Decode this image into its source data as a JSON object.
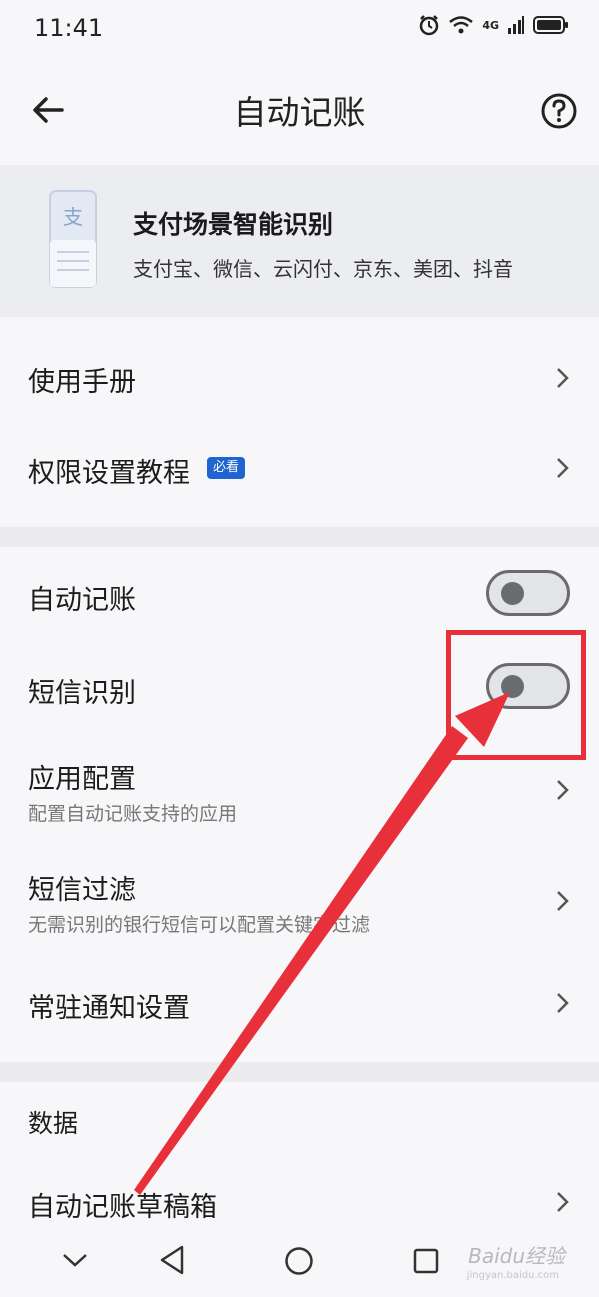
{
  "status_bar": {
    "time": "11:41",
    "network": "4G"
  },
  "header": {
    "title": "自动记账",
    "back_icon": "arrow-left-icon",
    "help_icon": "question-circle-icon"
  },
  "banner": {
    "title": "支付场景智能识别",
    "subtitle": "支付宝、微信、云闪付、京东、美团、抖音",
    "icon_glyph": "支"
  },
  "group1": {
    "manual": "使用手册",
    "permission_tutorial": "权限设置教程",
    "badge": "必看"
  },
  "group2": {
    "auto_bookkeeping": {
      "label": "自动记账",
      "enabled": false
    },
    "sms_recognition": {
      "label": "短信识别",
      "enabled": false
    },
    "app_config": {
      "label": "应用配置",
      "sub": "配置自动记账支持的应用"
    },
    "sms_filter": {
      "label": "短信过滤",
      "sub": "无需识别的银行短信可以配置关键字过滤"
    },
    "notification": {
      "label": "常驻通知设置"
    }
  },
  "group3": {
    "section_title": "数据",
    "drafts": "自动记账草稿箱"
  },
  "watermark": {
    "brand": "Baidu经验",
    "url": "jingyan.baidu.com"
  },
  "colors": {
    "accent_red": "#e8303a",
    "badge_blue": "#1f64d0",
    "banner_bg": "#ecedf0",
    "page_bg": "#f7f7f9"
  }
}
